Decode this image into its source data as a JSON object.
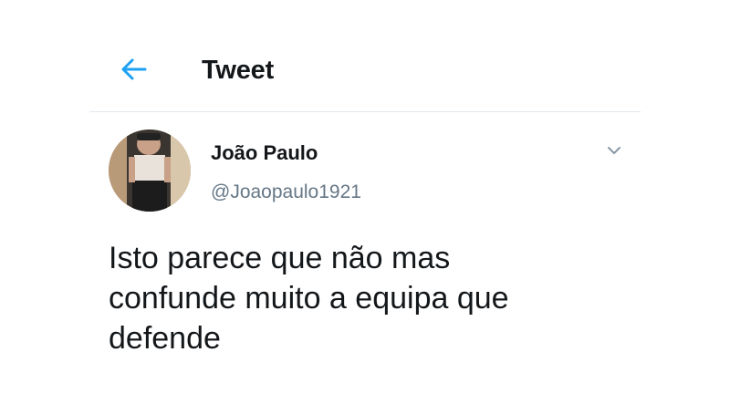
{
  "header": {
    "back_icon": "arrow-left-icon",
    "title": "Tweet"
  },
  "tweet": {
    "author": {
      "display_name": "João Paulo",
      "handle": "@Joaopaulo1921",
      "avatar": "profile-photo"
    },
    "more_icon": "chevron-down-icon",
    "text": "Isto parece que não mas\nconfunde muito a equipa que\ndefende"
  },
  "colors": {
    "accent": "#1da1f2",
    "text_primary": "#14171a",
    "text_secondary": "#657786",
    "divider": "#e1e8ed",
    "chevron": "#8899a6"
  }
}
